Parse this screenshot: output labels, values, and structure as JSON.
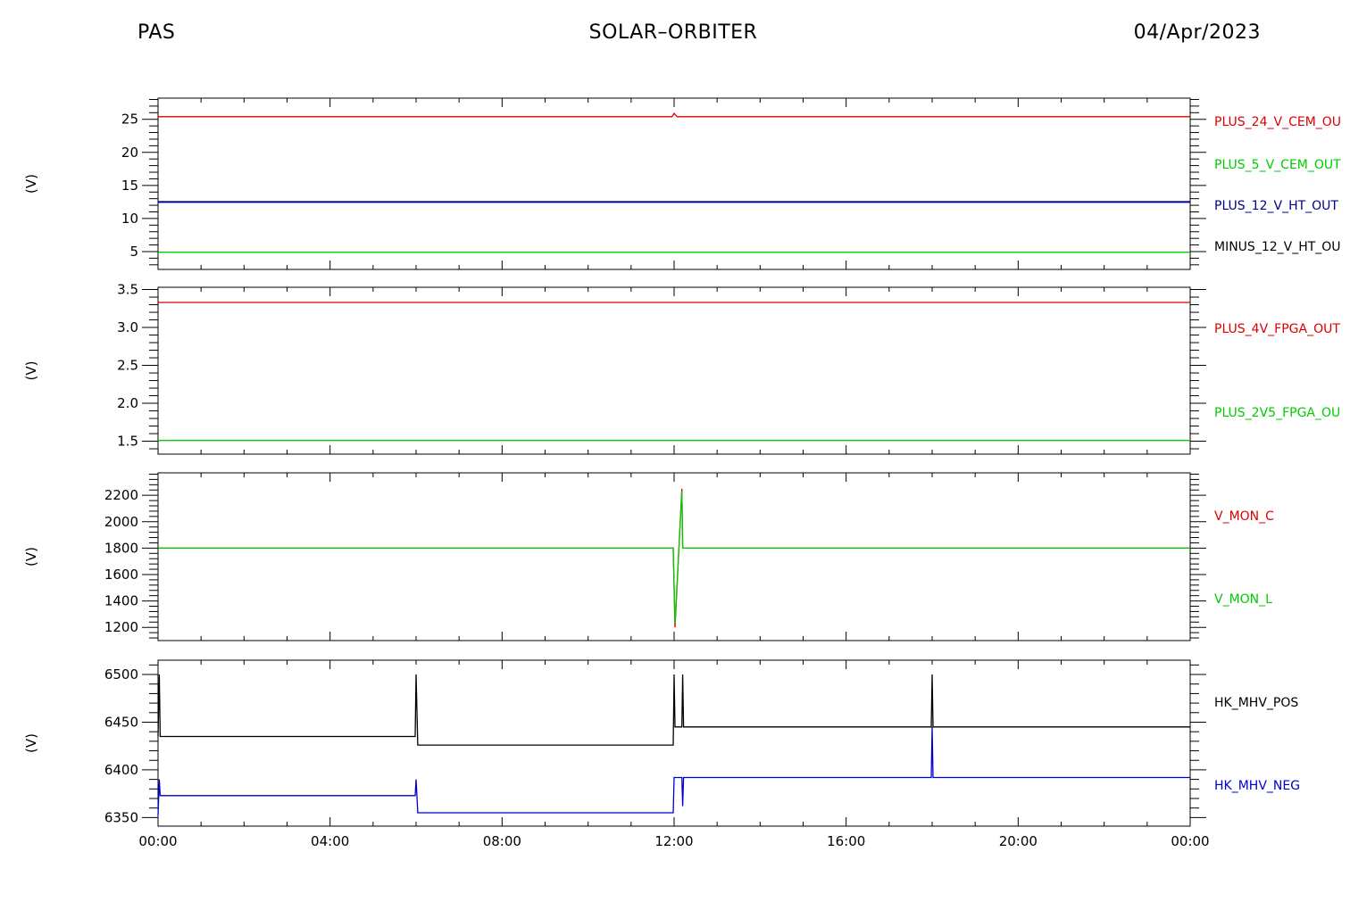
{
  "header": {
    "left": "PAS",
    "center": "SOLAR–ORBITER",
    "right": "04/Apr/2023"
  },
  "x_axis": {
    "ticks": [
      "00:00",
      "04:00",
      "08:00",
      "12:00",
      "16:00",
      "20:00",
      "00:00"
    ]
  },
  "chart_data": [
    {
      "type": "line",
      "ylabel": "(V)",
      "ylim": [
        2.3,
        28.2
      ],
      "yticks": [
        5,
        10,
        15,
        20,
        25
      ],
      "xunit": "hours since 00:00",
      "series": [
        {
          "name": "PLUS_24_V_CEM_OU",
          "color": "#dd0000",
          "points": [
            [
              0,
              25.4
            ],
            [
              11.95,
              25.4
            ],
            [
              12.0,
              25.9
            ],
            [
              12.07,
              25.4
            ],
            [
              12.15,
              25.4
            ],
            [
              24,
              25.4
            ]
          ]
        },
        {
          "name": "PLUS_5_V_CEM_OUT",
          "color": "#00cc00",
          "points": [
            [
              0,
              4.9
            ],
            [
              24,
              4.9
            ]
          ]
        },
        {
          "name": "PLUS_12_V_HT_OUT",
          "color": "#00008b",
          "points": [
            [
              0,
              12.5
            ],
            [
              24,
              12.5
            ]
          ]
        },
        {
          "name": "MINUS_12_V_HT_OU",
          "color": "#000000",
          "points": []
        }
      ]
    },
    {
      "type": "line",
      "ylabel": "(V)",
      "ylim": [
        1.33,
        3.53
      ],
      "yticks": [
        1.5,
        2.0,
        2.5,
        3.0,
        3.5
      ],
      "xunit": "hours since 00:00",
      "series": [
        {
          "name": "PLUS_4V_FPGA_OUT",
          "color": "#dd0000",
          "points": [
            [
              0,
              3.33
            ],
            [
              24,
              3.33
            ]
          ]
        },
        {
          "name": "PLUS_2V5_FPGA_OU",
          "color": "#00cc00",
          "points": [
            [
              0,
              1.51
            ],
            [
              24,
              1.51
            ]
          ]
        }
      ]
    },
    {
      "type": "line",
      "ylabel": "(V)",
      "ylim": [
        1100,
        2370
      ],
      "yticks": [
        1200,
        1400,
        1600,
        1800,
        2000,
        2200
      ],
      "xunit": "hours since 00:00",
      "series": [
        {
          "name": "V_MON_C",
          "color": "#dd0000",
          "points": [
            [
              0,
              1800
            ],
            [
              11.98,
              1800
            ],
            [
              12.02,
              1200
            ],
            [
              12.18,
              2250
            ],
            [
              12.2,
              1800
            ],
            [
              24,
              1800
            ]
          ]
        },
        {
          "name": "V_MON_L",
          "color": "#00cc00",
          "points": [
            [
              0,
              1800
            ],
            [
              11.98,
              1800
            ],
            [
              12.02,
              1230
            ],
            [
              12.18,
              2230
            ],
            [
              12.2,
              1800
            ],
            [
              24,
              1800
            ]
          ]
        }
      ]
    },
    {
      "type": "line",
      "ylabel": "(V)",
      "ylim": [
        6341,
        6515
      ],
      "yticks": [
        6350,
        6400,
        6450,
        6500
      ],
      "xunit": "hours since 00:00",
      "series": [
        {
          "name": "HK_MHV_POS",
          "color": "#000000",
          "points": [
            [
              0,
              6435
            ],
            [
              0.03,
              6500
            ],
            [
              0.05,
              6435
            ],
            [
              5.98,
              6435
            ],
            [
              6.0,
              6500
            ],
            [
              6.04,
              6426
            ],
            [
              11.98,
              6426
            ],
            [
              12.0,
              6500
            ],
            [
              12.02,
              6445
            ],
            [
              12.18,
              6445
            ],
            [
              12.2,
              6500
            ],
            [
              12.22,
              6445
            ],
            [
              17.98,
              6445
            ],
            [
              18.0,
              6500
            ],
            [
              18.02,
              6445
            ],
            [
              24,
              6445
            ]
          ]
        },
        {
          "name": "HK_MHV_NEG",
          "color": "#0000cc",
          "points": [
            [
              0,
              6352
            ],
            [
              0.03,
              6390
            ],
            [
              0.05,
              6373
            ],
            [
              5.98,
              6373
            ],
            [
              6.0,
              6390
            ],
            [
              6.04,
              6355
            ],
            [
              11.98,
              6355
            ],
            [
              12.0,
              6392
            ],
            [
              12.18,
              6392
            ],
            [
              12.2,
              6362
            ],
            [
              12.22,
              6392
            ],
            [
              17.98,
              6392
            ],
            [
              18.0,
              6445
            ],
            [
              18.02,
              6392
            ],
            [
              24,
              6392
            ]
          ]
        }
      ]
    }
  ]
}
